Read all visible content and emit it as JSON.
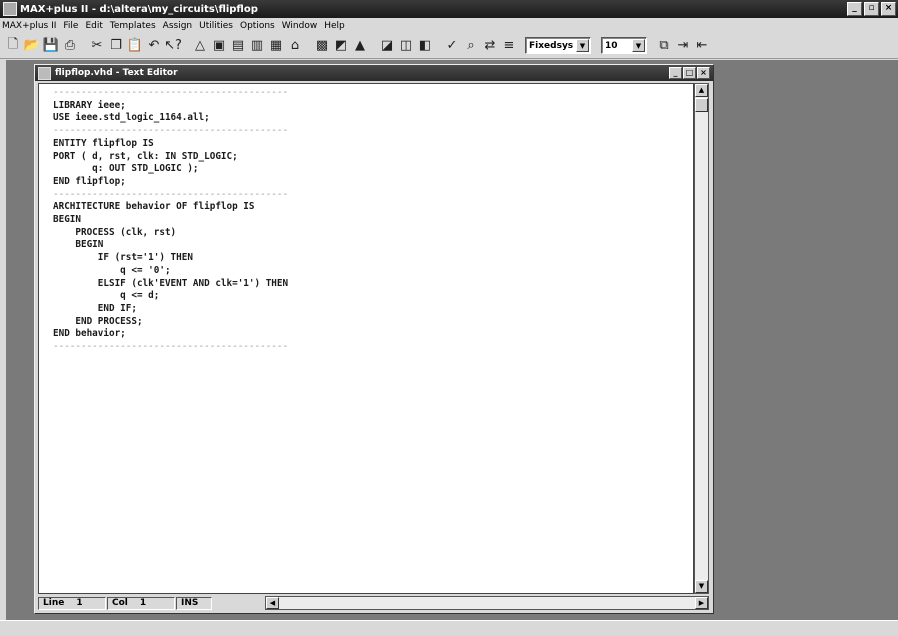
{
  "app": {
    "title": "MAX+plus II - d:\\altera\\my_circuits\\flipflop",
    "window_controls": [
      "_",
      "▫",
      "×"
    ]
  },
  "menu": [
    "MAX+plus II",
    "File",
    "Edit",
    "Templates",
    "Assign",
    "Utilities",
    "Options",
    "Window",
    "Help"
  ],
  "toolbar": {
    "icons": [
      "new-file-icon",
      "open-icon",
      "save-icon",
      "print-icon",
      "cut-icon",
      "copy-icon",
      "paste-icon",
      "undo-icon",
      "help-pointer-icon",
      "hierarchy-icon",
      "compile-icon",
      "simulate-icon",
      "timing-icon",
      "waveform-icon",
      "programmer-icon",
      "floorplan-icon",
      "symbol-icon",
      "text-icon",
      "graphic-icon",
      "open-file-icon",
      "save-all-icon",
      "check-icon",
      "find-icon",
      "replace-icon",
      "font-icon"
    ],
    "font": "Fixedsys",
    "size": "10"
  },
  "editor": {
    "title": "flipflop.vhd - Text Editor",
    "code": [
      {
        "t": "------------------------------------------",
        "dash": true
      },
      {
        "t": "LIBRARY ieee;"
      },
      {
        "t": "USE ieee.std_logic_1164.all;"
      },
      {
        "t": "------------------------------------------",
        "dash": true
      },
      {
        "t": "ENTITY flipflop IS"
      },
      {
        "t": "PORT ( d, rst, clk: IN STD_LOGIC;"
      },
      {
        "t": "       q: OUT STD_LOGIC );"
      },
      {
        "t": "END flipflop;"
      },
      {
        "t": "------------------------------------------",
        "dash": true
      },
      {
        "t": "ARCHITECTURE behavior OF flipflop IS"
      },
      {
        "t": "BEGIN"
      },
      {
        "t": "    PROCESS (clk, rst)"
      },
      {
        "t": "    BEGIN"
      },
      {
        "t": "        IF (rst='1') THEN"
      },
      {
        "t": "            q <= '0';"
      },
      {
        "t": "        ELSIF (clk'EVENT AND clk='1') THEN"
      },
      {
        "t": "            q <= d;"
      },
      {
        "t": "        END IF;"
      },
      {
        "t": "    END PROCESS;"
      },
      {
        "t": "END behavior;"
      },
      {
        "t": "------------------------------------------",
        "dash": true
      }
    ],
    "status": {
      "line_label": "Line",
      "line_value": "1",
      "col_label": "Col",
      "col_value": "1",
      "mode": "INS"
    }
  }
}
